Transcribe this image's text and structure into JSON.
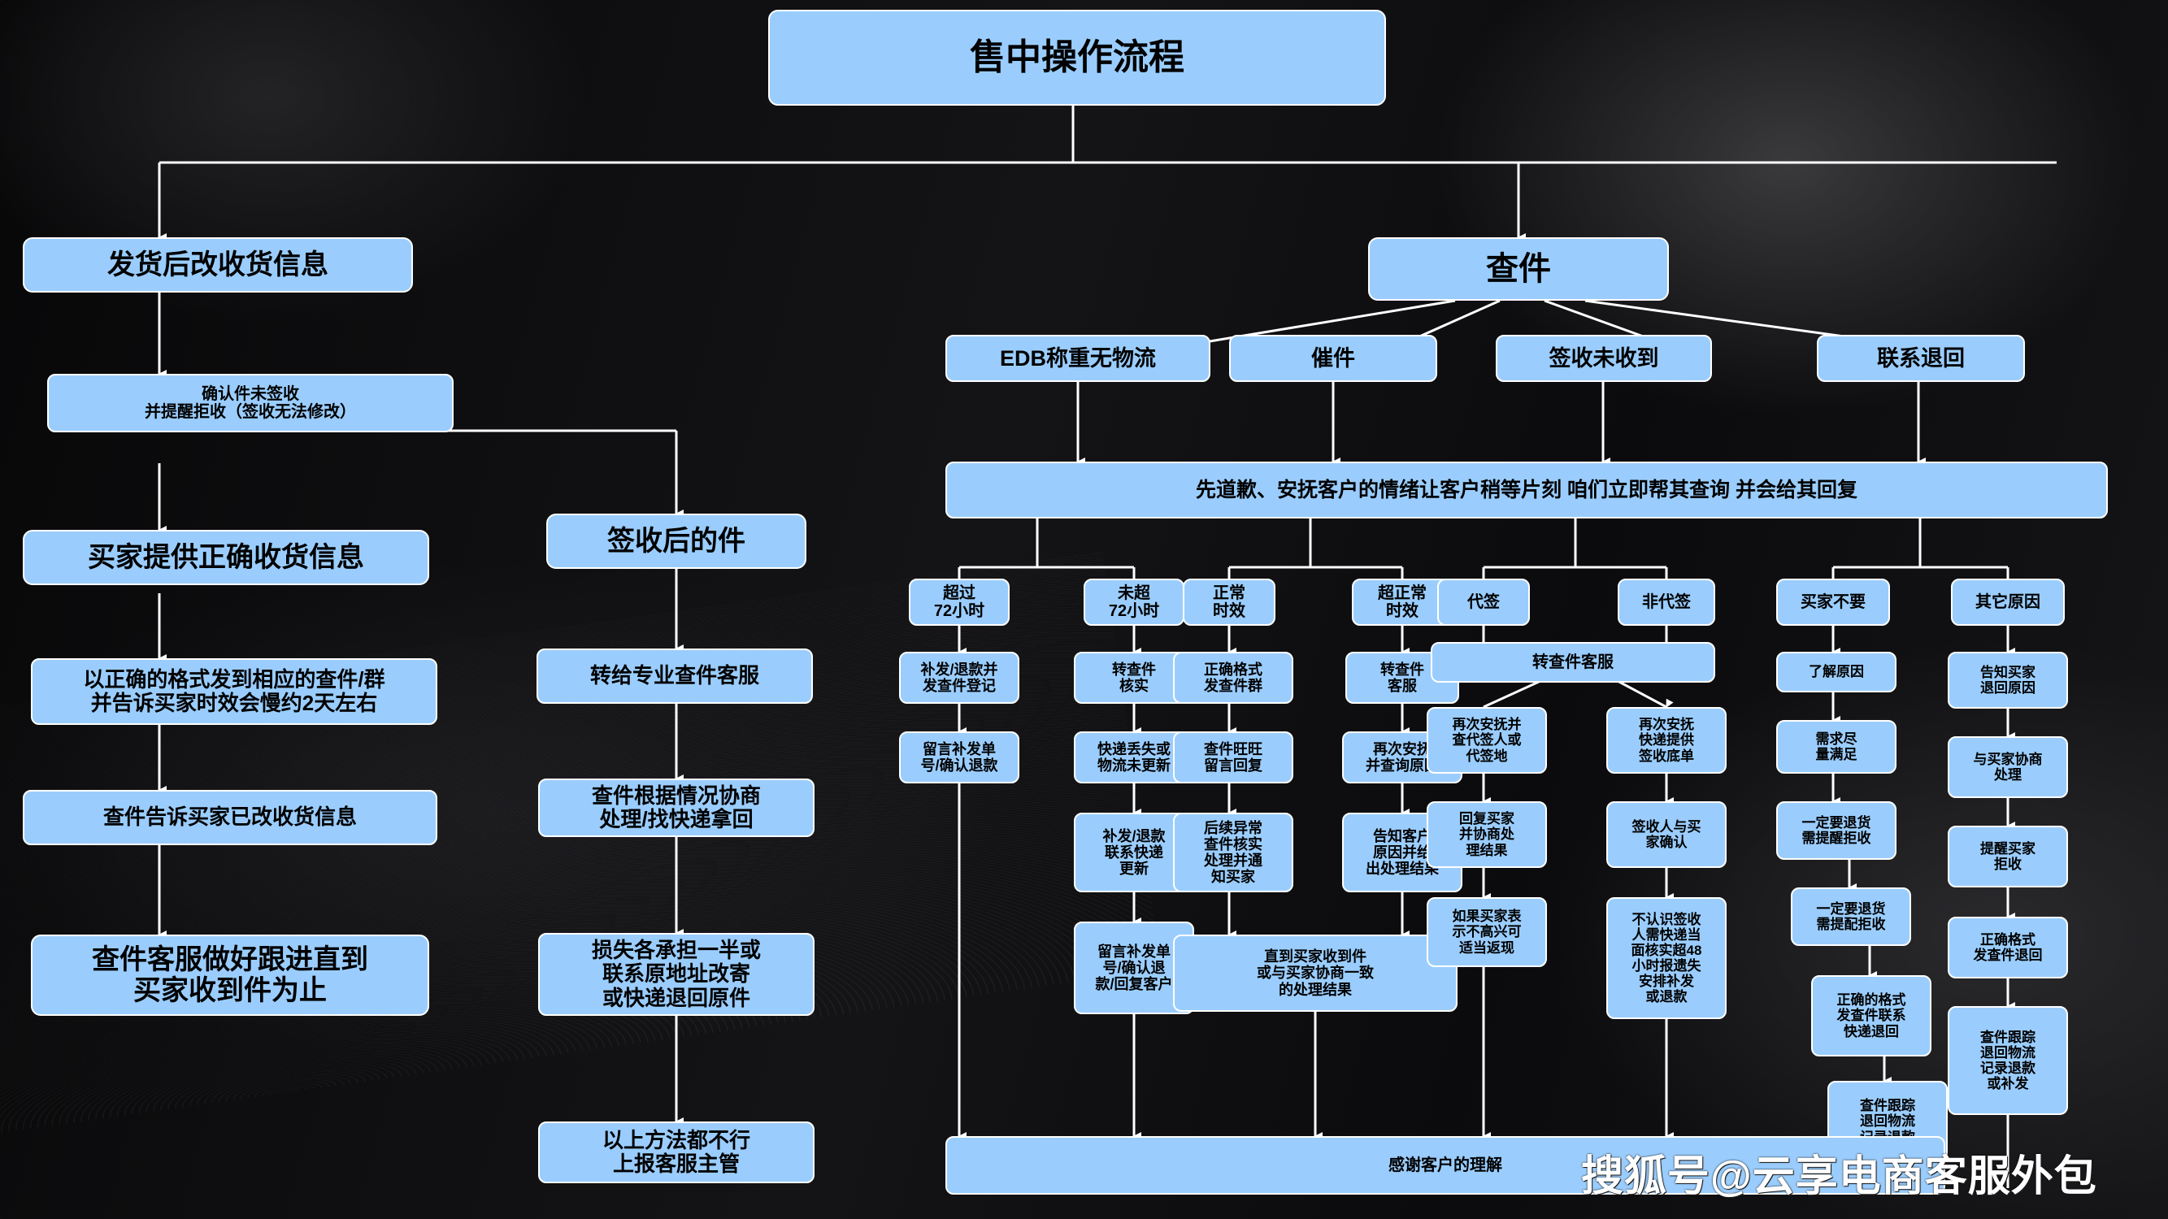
{
  "title": "售中操作流程",
  "watermark": "搜狐号@云享电商客服外包",
  "colors": {
    "node_fill": "#9ACDFD",
    "node_border": "#FFFFFF",
    "node_text": "#000000",
    "connector": "#FFFFFF",
    "background": "#0D0D0F"
  },
  "branches": {
    "left": {
      "root": "发货后改收货信息",
      "confirm": "确认件未签收\n并提醒拒收（签收无法修改）",
      "chain_a": [
        "买家提供正确收货信息",
        "以正确的格式发到相应的查件/群\n并告诉买家时效会慢约2天左右",
        "查件告诉买家已改收货信息",
        "查件客服做好跟进直到\n买家收到件为止"
      ],
      "chain_b": [
        "签收后的件",
        "转给专业查件客服",
        "查件根据情况协商\n处理/找快递拿回",
        "损失各承担一半或\n联系原地址改寄\n或快递退回原件",
        "以上方法都不行\n上报客服主管"
      ]
    },
    "right": {
      "root": "查件",
      "categories": [
        "EDB称重无物流",
        "催件",
        "签收未收到",
        "联系退回"
      ],
      "apology": "先道歉、安抚客户的情绪让客户稍等片刻 咱们立即帮其查询 并会给其回复",
      "thanks": "感谢客户的理解",
      "columns": [
        {
          "label": "超过\n72小时",
          "steps": [
            "补发/退款并\n发查件登记",
            "留言补发单\n号/确认退款"
          ]
        },
        {
          "label": "未超\n72小时",
          "steps": [
            "转查件\n核实",
            "快递丢失或\n物流未更新",
            "补发/退款\n联系快递\n更新",
            "留言补发单\n号/确认退\n款/回复客户"
          ]
        },
        {
          "label": "正常\n时效",
          "steps": [
            "正确格式\n发查件群",
            "查件旺旺\n留言回复",
            "后续异常\n查件核实\n处理并通\n知买家"
          ]
        },
        {
          "label": "超正常\n时效",
          "steps": [
            "转查件\n客服",
            "再次安抚\n并查询原因",
            "告知客户\n原因并给\n出处理结果"
          ]
        },
        {
          "label": "代签",
          "steps": [
            "再次安抚并\n查代签人或\n代签地",
            "回复买家\n并协商处\n理结果",
            "如果买家表\n示不高兴可\n适当返现"
          ]
        },
        {
          "label": "非代签",
          "steps": [
            "再次安抚\n快递提供\n签收底单",
            "签收人与买\n家确认",
            "不认识签收\n人需快递当\n面核实超48\n小时报遗失\n安排补发\n或退款"
          ]
        },
        {
          "label": "买家不要",
          "steps": [
            "了解原因",
            "需求尽\n量满足",
            "一定要退货\n需提醒拒收",
            "一定要退货\n需提配拒收",
            "正确的格式\n发查件联系\n快递退回",
            "查件跟踪\n退回物流\n记录退款"
          ]
        },
        {
          "label": "其它原因",
          "steps": [
            "告知买家\n退回原因",
            "与买家协商\n处理",
            "提醒买家\n拒收",
            "正确格式\n发查件退回",
            "查件跟踪\n退回物流\n记录退款\n或补发"
          ]
        }
      ],
      "shared": {
        "transfer_cs": "转查件客服",
        "until_result": "直到买家收到件\n或与买家协商一致\n的处理结果"
      }
    }
  }
}
